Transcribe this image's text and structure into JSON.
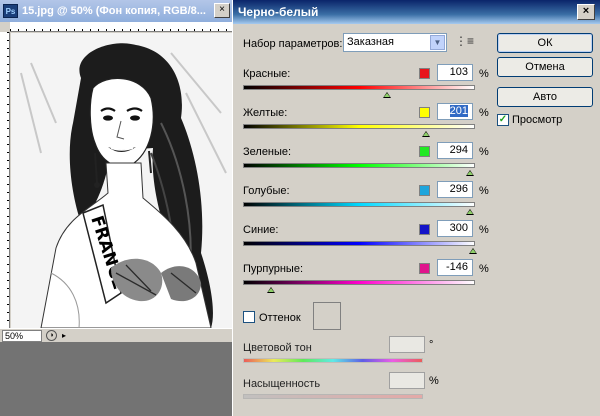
{
  "document": {
    "title": "15.jpg @ 50% (Фон копия, RGB/8...",
    "app_icon": "Ps",
    "close": "×",
    "zoom": "50%"
  },
  "dialog": {
    "title": "Черно-белый",
    "close": "×",
    "preset_label": "Набор параметров:",
    "preset_value": "Заказная",
    "buttons": {
      "ok": "ОК",
      "cancel": "Отмена",
      "auto": "Авто"
    },
    "preview_label": "Просмотр",
    "preview_checked": true,
    "sliders": [
      {
        "label": "Красные:",
        "value": "103",
        "unit": "%",
        "swatch": "#e8141c",
        "position": 0.62,
        "gradient": [
          "#000000",
          "#ff0000",
          "#ffffff"
        ]
      },
      {
        "label": "Желтые:",
        "value": "201",
        "unit": "%",
        "swatch": "#ffff00",
        "position": 0.79,
        "gradient": [
          "#000000",
          "#ffff00",
          "#ffffff"
        ],
        "selected": true
      },
      {
        "label": "Зеленые:",
        "value": "294",
        "unit": "%",
        "swatch": "#22e822",
        "position": 0.98,
        "gradient": [
          "#000000",
          "#00ff00",
          "#ffffff"
        ]
      },
      {
        "label": "Голубые:",
        "value": "296",
        "unit": "%",
        "swatch": "#1ea5dc",
        "position": 0.98,
        "gradient": [
          "#000000",
          "#00d8ff",
          "#ffffff"
        ]
      },
      {
        "label": "Синие:",
        "value": "300",
        "unit": "%",
        "swatch": "#1414c8",
        "position": 0.99,
        "gradient": [
          "#000000",
          "#0000ff",
          "#ffffff"
        ]
      },
      {
        "label": "Пурпурные:",
        "value": "-146",
        "unit": "%",
        "swatch": "#e0148c",
        "position": 0.12,
        "gradient": [
          "#000000",
          "#ff00cc",
          "#ffffff"
        ]
      }
    ],
    "tint_label": "Оттенок",
    "tint_checked": false,
    "hue_label": "Цветовой тон",
    "hue_unit": "°",
    "saturation_label": "Насыщенность",
    "saturation_unit": "%"
  }
}
